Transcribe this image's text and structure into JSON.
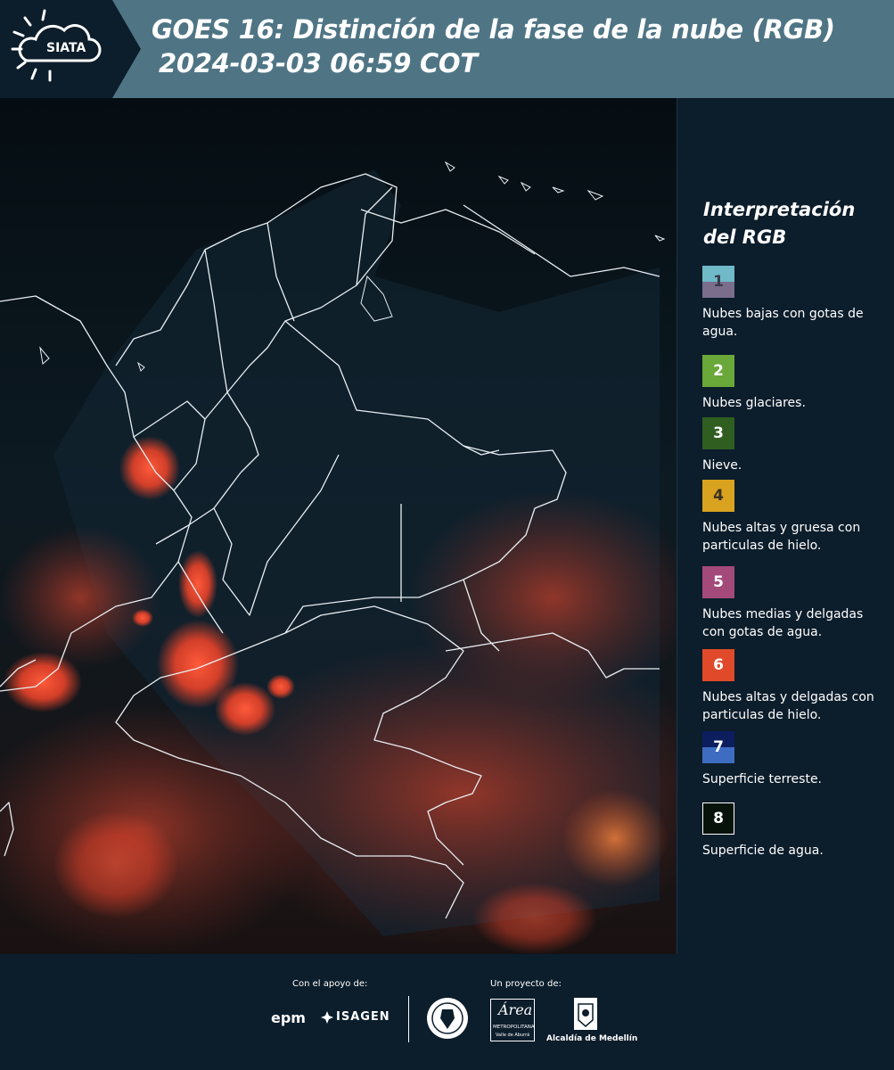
{
  "header": {
    "logo_text": "SIATA",
    "title_line1": "GOES 16: Distinción de la fase de la nube (RGB)",
    "title_line2": "2024-03-03 06:59 COT"
  },
  "legend": {
    "title_line1": "Interpretación",
    "title_line2": "del RGB",
    "items": [
      {
        "number": "1",
        "label": "Nubes bajas con gotas de agua.",
        "color_top": "#6fb9c8",
        "color_bottom": "#7a6e8c",
        "text_color": "#3a3a4a"
      },
      {
        "number": "2",
        "label": "Nubes glaciares.",
        "color_top": "#6aa83a",
        "color_bottom": "#6aa83a",
        "text_color": "#ffffff"
      },
      {
        "number": "3",
        "label": "Nieve.",
        "color_top": "#2f5e20",
        "color_bottom": "#2f5e20",
        "text_color": "#ffffff"
      },
      {
        "number": "4",
        "label": "Nubes altas y gruesa con particulas de hielo.",
        "color_top": "#d9a21f",
        "color_bottom": "#d9a21f",
        "text_color": "#3a3220"
      },
      {
        "number": "5",
        "label": "Nubes medias y delgadas con gotas de agua.",
        "color_top": "#a44a7a",
        "color_bottom": "#a44a7a",
        "text_color": "#ffffff"
      },
      {
        "number": "6",
        "label": "Nubes altas y delgadas con particulas de hielo.",
        "color_top": "#e04a2a",
        "color_bottom": "#e04a2a",
        "text_color": "#ffffff"
      },
      {
        "number": "7",
        "label": "Superficie terreste.",
        "color_top": "#0c1e5e",
        "color_bottom": "#3e6cc0",
        "text_color": "#ffffff"
      },
      {
        "number": "8",
        "label": "Superficie de agua.",
        "color_top": "#07120b",
        "color_bottom": "#07120b",
        "text_color": "#ffffff"
      }
    ]
  },
  "footer": {
    "support_label": "Con el apoyo de:",
    "project_label": "Un proyecto de:",
    "epm": "epm",
    "isagen": "ISAGEN",
    "area_line1": "Área",
    "area_line2": "METROPOLITANA",
    "area_line3": "Valle de Aburrá",
    "alcaldia": "Alcaldía de Medellín"
  },
  "colors": {
    "header_bg": "#4f7585",
    "header_tab": "#0c1d2b",
    "panel_bg": "#0c1d2b",
    "cloud_red": "#e8432a"
  }
}
